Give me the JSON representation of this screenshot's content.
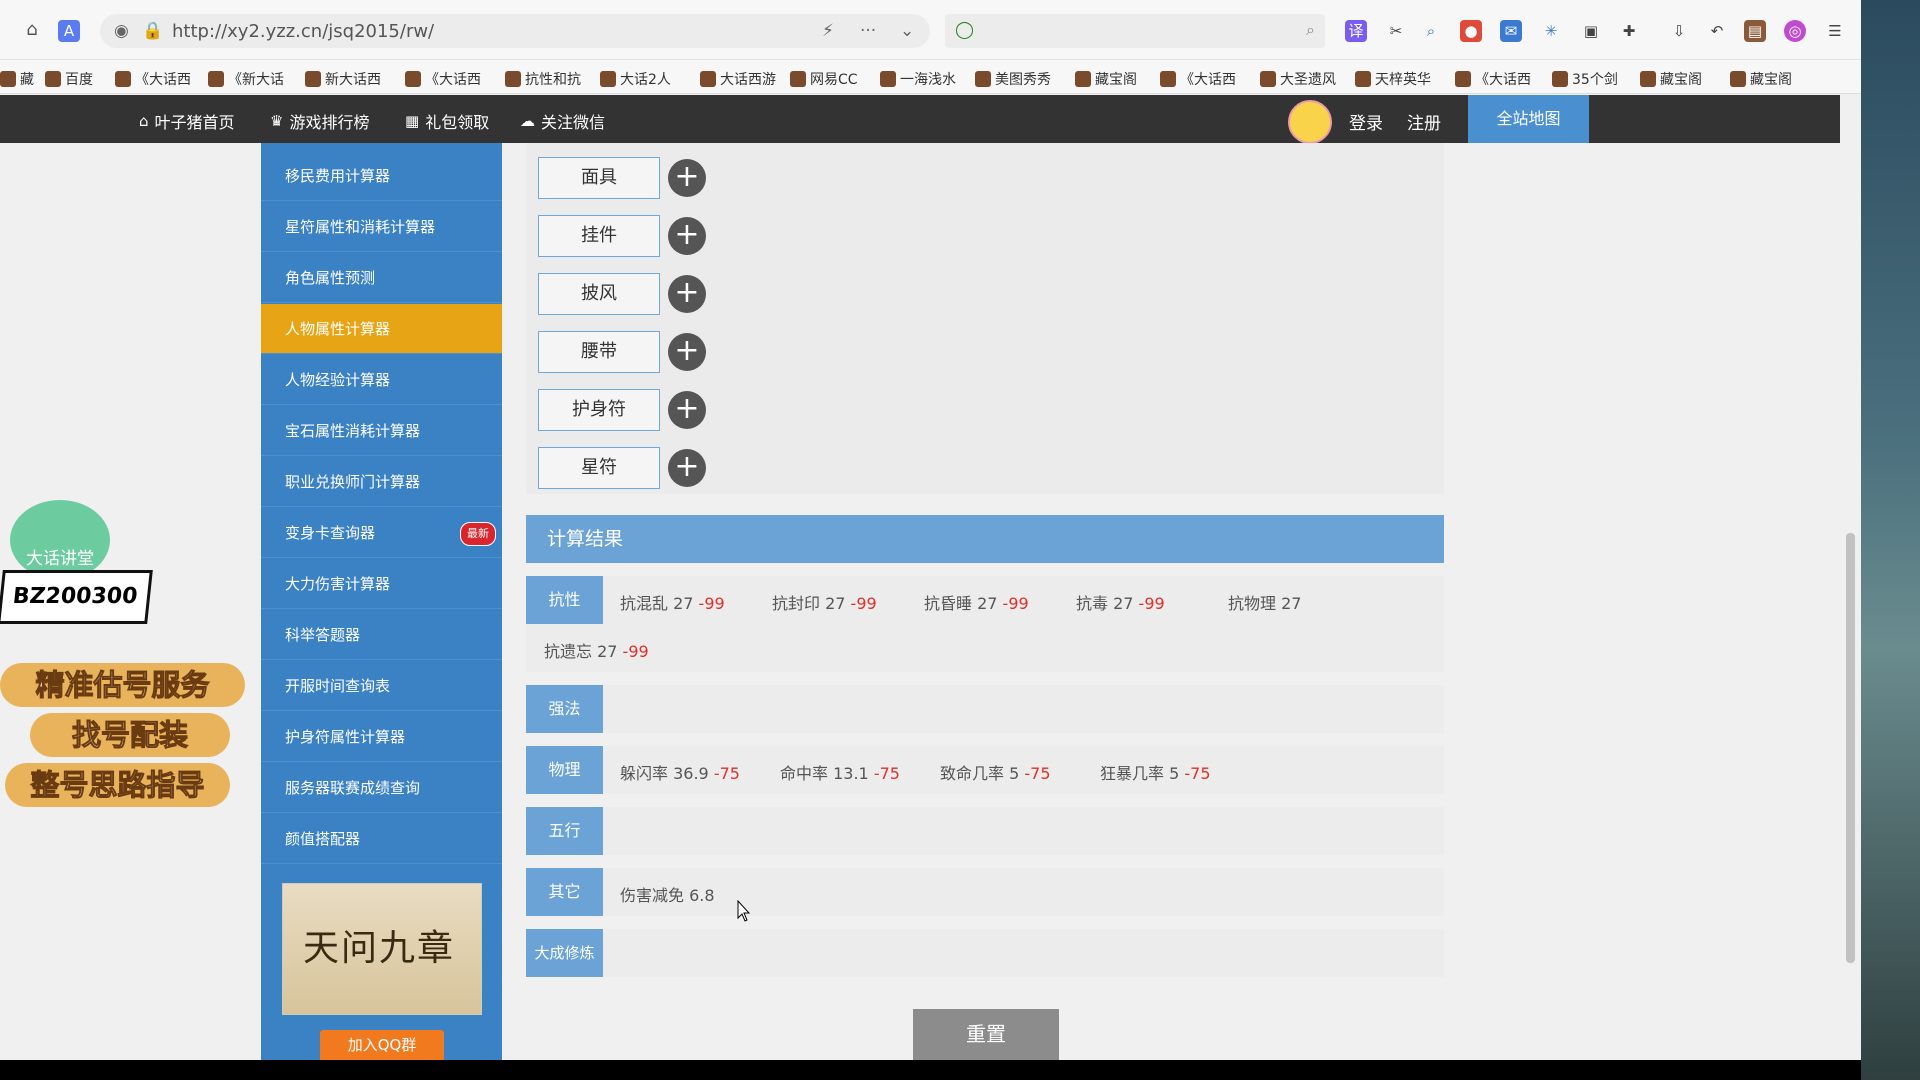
{
  "browser": {
    "url": "http://xy2.yzz.cn/jsq2015/rw/",
    "bookmarks": [
      "藏",
      "百度",
      "《大话西",
      "《新大话",
      "新大话西",
      "《大话西",
      "抗性和抗",
      "大话2人",
      "大话西游",
      "网易CC",
      "一海浅水",
      "美图秀秀",
      "藏宝阁",
      "《大话西",
      "大圣遗风",
      "天梓英华",
      "《大话西",
      "35个剑",
      "藏宝阁",
      "藏宝阁"
    ]
  },
  "site_nav": {
    "items": [
      "叶子猪首页",
      "游戏排行榜",
      "礼包领取",
      "关注微信"
    ],
    "login": "登录",
    "register": "注册",
    "sitemap": "全站地图"
  },
  "sidebar": {
    "items": [
      {
        "label": "移民费用计算器"
      },
      {
        "label": "星符属性和消耗计算器"
      },
      {
        "label": "角色属性预测"
      },
      {
        "label": "人物属性计算器",
        "active": true
      },
      {
        "label": "人物经验计算器"
      },
      {
        "label": "宝石属性消耗计算器"
      },
      {
        "label": "职业兑换师门计算器"
      },
      {
        "label": "变身卡查询器",
        "badge": "最新"
      },
      {
        "label": "大力伤害计算器"
      },
      {
        "label": "科举答题器"
      },
      {
        "label": "开服时间查询表"
      },
      {
        "label": "护身符属性计算器"
      },
      {
        "label": "服务器联赛成绩查询"
      },
      {
        "label": "颜值搭配器"
      }
    ],
    "banner_title": "天问九章",
    "qq_button": "加入QQ群"
  },
  "equipment": {
    "slots": [
      "面具",
      "挂件",
      "披风",
      "腰带",
      "护身符",
      "星符"
    ],
    "add_symbol": "+"
  },
  "results": {
    "title": "计算结果",
    "rows": [
      {
        "tag": "抗性",
        "values": [
          {
            "label": "抗混乱 27",
            "delta": "-99"
          },
          {
            "label": "抗封印 27",
            "delta": "-99"
          },
          {
            "label": "抗昏睡 27",
            "delta": "-99"
          },
          {
            "label": "抗毒 27",
            "delta": "-99"
          },
          {
            "label": "抗物理 27",
            "delta": ""
          },
          {
            "label": "抗遗忘 27",
            "delta": "-99"
          }
        ]
      },
      {
        "tag": "强法",
        "values": []
      },
      {
        "tag": "物理",
        "values": [
          {
            "label": "躲闪率 36.9",
            "delta": "-75"
          },
          {
            "label": "命中率 13.1",
            "delta": "-75"
          },
          {
            "label": "致命几率 5",
            "delta": "-75"
          },
          {
            "label": "狂暴几率 5",
            "delta": "-75"
          }
        ]
      },
      {
        "tag": "五行",
        "values": []
      },
      {
        "tag": "其它",
        "values": [
          {
            "label": "伤害减免 6.8",
            "delta": ""
          }
        ]
      },
      {
        "tag": "大成修炼",
        "values": []
      }
    ],
    "reset": "重置"
  },
  "ad": {
    "badge": "大话讲堂",
    "code": "BZ200300",
    "lines": [
      "精准估号服务",
      "找号配装",
      "整号思路指导"
    ]
  },
  "colors": {
    "accent": "#6ba3d6",
    "sidebar": "#3b82c4",
    "active": "#e7a415",
    "red": "#e0302a"
  }
}
